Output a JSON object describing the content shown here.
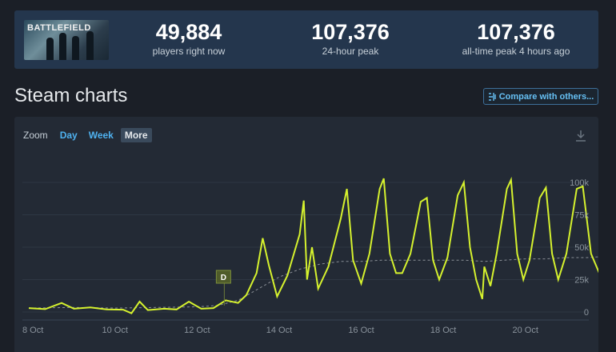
{
  "stats": [
    {
      "value": "49,884",
      "label": "players right now"
    },
    {
      "value": "107,376",
      "label": "24-hour peak"
    },
    {
      "value": "107,376",
      "label": "all-time peak 4 hours ago"
    }
  ],
  "thumbnail_logo": "BATTLEFIELD",
  "section_title": "Steam charts",
  "compare_label": "Compare with others...",
  "zoom": {
    "label": "Zoom",
    "options": [
      "Day",
      "Week",
      "More"
    ],
    "active": "More"
  },
  "colors": {
    "line": "#d6f22e",
    "avg": "#8a8f96",
    "accent": "#66c0f4",
    "panel": "#232a35"
  },
  "chart_data": {
    "type": "line",
    "xlabels": [
      "8 Oct",
      "10 Oct",
      "12 Oct",
      "14 Oct",
      "16 Oct",
      "18 Oct",
      "20 Oct"
    ],
    "ytick_labels": [
      "0",
      "25k",
      "50k",
      "75k",
      "100k"
    ],
    "ylim": [
      0,
      107376
    ],
    "x_start_day": 7.9,
    "marker": {
      "label": "D",
      "day": 12.8
    },
    "series": [
      {
        "values": [
          [
            7.9,
            3000
          ],
          [
            8.3,
            2200
          ],
          [
            8.7,
            7000
          ],
          [
            9.0,
            2500
          ],
          [
            9.4,
            3500
          ],
          [
            9.8,
            2000
          ],
          [
            10.2,
            1800
          ],
          [
            10.4,
            -1000
          ],
          [
            10.6,
            8000
          ],
          [
            10.8,
            1500
          ],
          [
            11.2,
            2500
          ],
          [
            11.5,
            2000
          ],
          [
            11.8,
            8000
          ],
          [
            12.1,
            2500
          ],
          [
            12.4,
            3000
          ],
          [
            12.7,
            9000
          ],
          [
            13.0,
            7000
          ],
          [
            13.2,
            13000
          ],
          [
            13.45,
            30000
          ],
          [
            13.6,
            57000
          ],
          [
            13.75,
            36000
          ],
          [
            13.95,
            12000
          ],
          [
            14.2,
            28000
          ],
          [
            14.5,
            60000
          ],
          [
            14.6,
            86000
          ],
          [
            14.68,
            25000
          ],
          [
            14.8,
            50000
          ],
          [
            14.95,
            18000
          ],
          [
            15.2,
            35000
          ],
          [
            15.5,
            72000
          ],
          [
            15.65,
            95000
          ],
          [
            15.8,
            40000
          ],
          [
            16.0,
            22000
          ],
          [
            16.2,
            45000
          ],
          [
            16.45,
            95000
          ],
          [
            16.55,
            103000
          ],
          [
            16.7,
            45000
          ],
          [
            16.85,
            30000
          ],
          [
            17.0,
            30000
          ],
          [
            17.2,
            45000
          ],
          [
            17.45,
            85000
          ],
          [
            17.6,
            88000
          ],
          [
            17.75,
            40000
          ],
          [
            17.9,
            25000
          ],
          [
            18.1,
            42000
          ],
          [
            18.35,
            90000
          ],
          [
            18.5,
            100000
          ],
          [
            18.65,
            50000
          ],
          [
            18.8,
            25000
          ],
          [
            18.95,
            10000
          ],
          [
            19.0,
            35000
          ],
          [
            19.15,
            20000
          ],
          [
            19.3,
            45000
          ],
          [
            19.55,
            95000
          ],
          [
            19.65,
            102000
          ],
          [
            19.8,
            45000
          ],
          [
            19.95,
            25000
          ],
          [
            20.1,
            40000
          ],
          [
            20.35,
            88000
          ],
          [
            20.5,
            96000
          ],
          [
            20.65,
            45000
          ],
          [
            20.8,
            25000
          ],
          [
            21.0,
            45000
          ],
          [
            21.25,
            95000
          ],
          [
            21.4,
            97000
          ],
          [
            21.6,
            45000
          ],
          [
            21.8,
            30000
          ],
          [
            22.05,
            60000
          ],
          [
            22.2,
            66000
          ],
          [
            22.35,
            40000
          ],
          [
            22.5,
            85000
          ],
          [
            22.65,
            107376
          ],
          [
            22.8,
            80000
          ],
          [
            22.88,
            50000
          ]
        ]
      },
      {
        "values": [
          [
            7.9,
            3000
          ],
          [
            9.0,
            3500
          ],
          [
            10.0,
            3000
          ],
          [
            11.0,
            3500
          ],
          [
            12.0,
            4000
          ],
          [
            12.5,
            5000
          ],
          [
            13.0,
            9000
          ],
          [
            13.5,
            18000
          ],
          [
            14.0,
            27000
          ],
          [
            14.5,
            33000
          ],
          [
            15.0,
            37000
          ],
          [
            15.5,
            39000
          ],
          [
            16.0,
            39000
          ],
          [
            16.5,
            40000
          ],
          [
            17.0,
            40000
          ],
          [
            17.5,
            40000
          ],
          [
            18.0,
            40000
          ],
          [
            18.5,
            40000
          ],
          [
            19.0,
            39000
          ],
          [
            19.5,
            40000
          ],
          [
            20.0,
            41000
          ],
          [
            20.5,
            41000
          ],
          [
            21.0,
            42000
          ],
          [
            21.5,
            42000
          ],
          [
            22.0,
            43000
          ],
          [
            22.5,
            44000
          ],
          [
            22.88,
            47000
          ]
        ]
      }
    ]
  }
}
